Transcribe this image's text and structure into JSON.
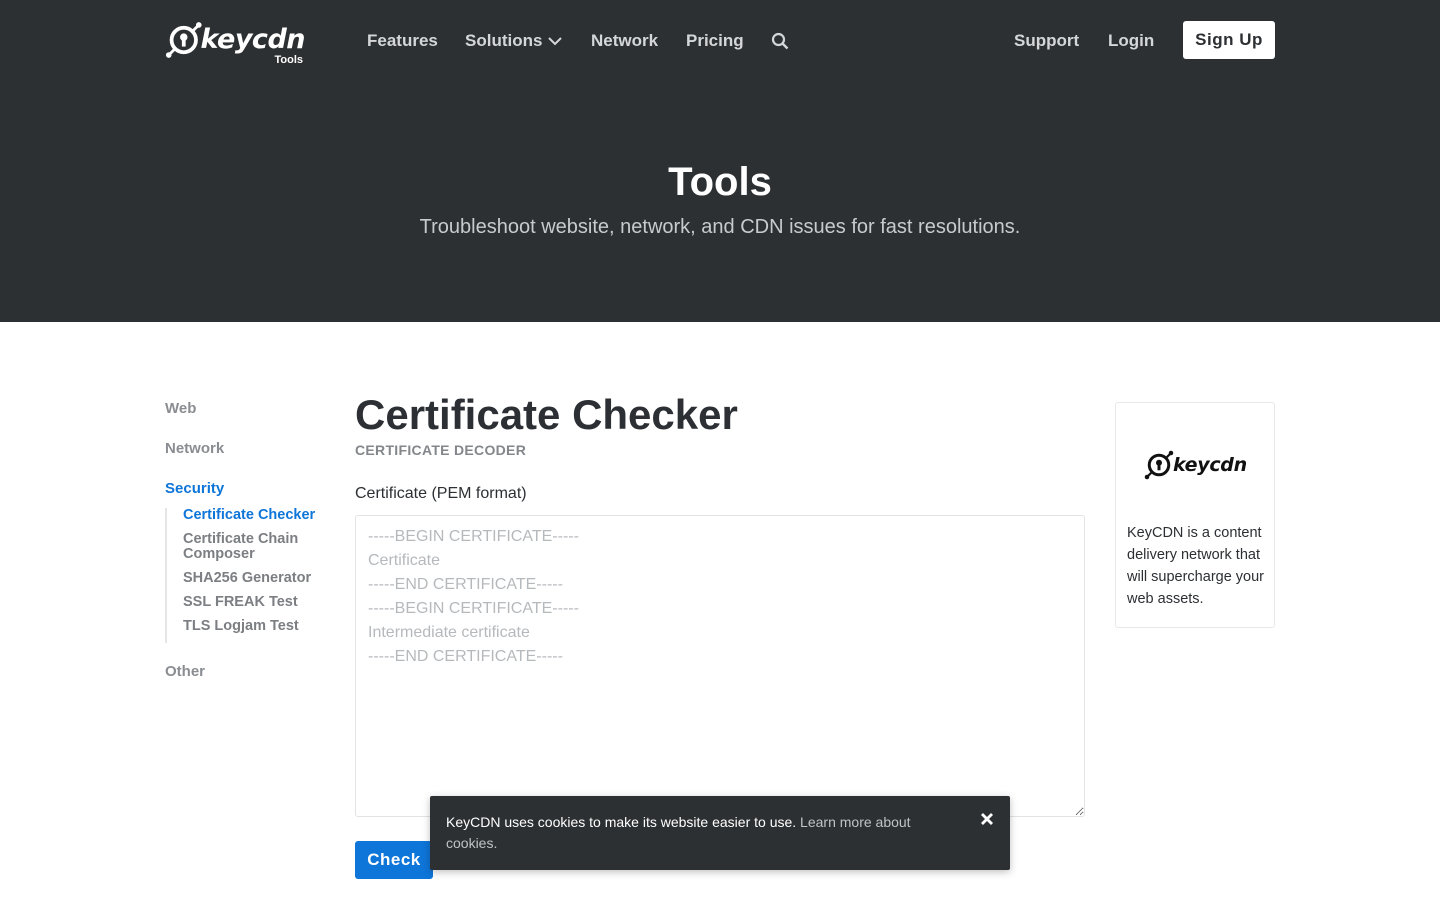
{
  "nav": {
    "logo_text": "keycdn",
    "logo_sub": "Tools",
    "logo_icon": "keycdn-logo-icon",
    "items": [
      "Features",
      "Solutions",
      "Network",
      "Pricing"
    ],
    "search_icon": "search-icon",
    "support": "Support",
    "login": "Login",
    "signup": "Sign Up"
  },
  "hero": {
    "title": "Tools",
    "subtitle": "Troubleshoot website, network, and CDN issues for fast resolutions."
  },
  "sidebar": {
    "categories": {
      "web": "Web",
      "network": "Network",
      "security": "Security",
      "other": "Other"
    },
    "security_items": [
      "Certificate Checker",
      "Certificate Chain Composer",
      "SHA256 Generator",
      "SSL FREAK Test",
      "TLS Logjam Test"
    ],
    "active_item": "Certificate Checker"
  },
  "main": {
    "title": "Certificate Checker",
    "kicker": "CERTIFICATE DECODER",
    "field_label": "Certificate (PEM format)",
    "placeholder": "-----BEGIN CERTIFICATE-----\nCertificate\n-----END CERTIFICATE-----\n-----BEGIN CERTIFICATE-----\nIntermediate certificate\n-----END CERTIFICATE-----",
    "value": "",
    "check_button": "Check"
  },
  "ad": {
    "logo_text": "keycdn",
    "text": "KeyCDN is a content delivery network that will supercharge your web assets."
  },
  "cookie": {
    "text": "KeyCDN uses cookies to make its website easier to use. ",
    "link": "Learn more about cookies.",
    "close_icon": "close-icon"
  },
  "colors": {
    "header_bg": "#2d3033",
    "accent": "#0e75d9",
    "white": "#ffffff"
  }
}
